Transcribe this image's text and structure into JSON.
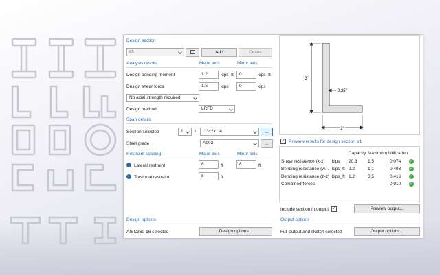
{
  "design_section": {
    "heading": "Design section",
    "selected": "s1",
    "add_label": "Add",
    "delete_label": "Delete"
  },
  "analysis": {
    "heading": "Analysis results",
    "major_axis": "Major axis",
    "minor_axis": "Minor axis",
    "moment_label": "Design bending moment",
    "moment_major": "1.2",
    "moment_major_unit": "kips_ft",
    "moment_minor": "0",
    "moment_minor_unit": "kips_ft",
    "shear_label": "Design shear force",
    "shear_major": "1.5",
    "shear_major_unit": "kips",
    "shear_minor": "0",
    "shear_minor_unit": "kips",
    "axial_option": "No axial strength required",
    "method_label": "Design method",
    "method_value": "LRFD"
  },
  "span": {
    "heading": "Span details",
    "section_label": "Section selected",
    "section_count": "1",
    "section_sep": "/",
    "section_value": "L 3x2x1/4",
    "browse_label": "...",
    "grade_label": "Steel grade",
    "grade_value": "A992"
  },
  "restraint": {
    "heading": "Restraint spacing",
    "major_axis": "Major axis",
    "minor_axis": "Minor axis",
    "lateral_label": "Lateral restraint",
    "lateral_major": "8",
    "lateral_major_unit": "ft",
    "lateral_minor": "8",
    "lateral_minor_unit": "ft",
    "torsional_label": "Torsional restraint",
    "torsional_major": "8",
    "torsional_major_unit": "ft"
  },
  "design_options": {
    "heading": "Design options",
    "status": "AISC360-16 selected",
    "button": "Design options..."
  },
  "sketch": {
    "height_label": "3\"",
    "thickness_label": "0.25\"",
    "width_label": "2\""
  },
  "preview": {
    "heading": "Preview results for design section",
    "section_name": "s1",
    "checked": "✓",
    "col_capacity": "Capacity",
    "col_maximum": "Maximum",
    "col_utilization": "Utilization",
    "rows": [
      {
        "name": "Shear resistance (x-x)",
        "unit": "kips",
        "capacity": "20.3",
        "maximum": "1.5",
        "utilization": "0.074"
      },
      {
        "name": "Bending resistance (w...",
        "unit": "kips_ft",
        "capacity": "2.2",
        "maximum": "1.1",
        "utilization": "0.493"
      },
      {
        "name": "Bending resistance (z-z)",
        "unit": "kips_ft",
        "capacity": "1.2",
        "maximum": "0.5",
        "utilization": "0.416"
      },
      {
        "name": "Combined forces",
        "unit": "",
        "capacity": "",
        "maximum": "",
        "utilization": "0.910"
      }
    ],
    "ok_glyph": "✓",
    "include_label": "Include section in output",
    "include_checked": "✓",
    "preview_button": "Preview output..."
  },
  "output_options": {
    "heading": "Output options",
    "status": "Full output and sketch selected",
    "button": "Output options..."
  },
  "colors": {
    "accent": "#2a6fb5",
    "ok": "#4aa84a",
    "section_fill": "#e2e2e2"
  }
}
